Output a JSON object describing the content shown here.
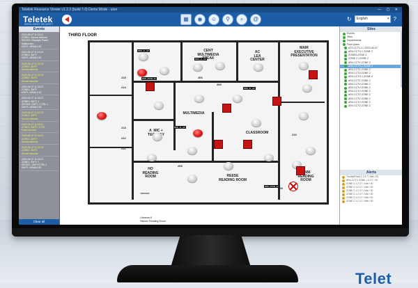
{
  "window": {
    "title": "Telelink Resource Viewer v1.2.3 (build 7.0) Demo Mode - user"
  },
  "header": {
    "logo": "Teletek",
    "logo_sub": "INTELLIGENT SECURITY",
    "toolbar_icons": [
      "grid-icon",
      "wifi-icon",
      "user-icon",
      "search-user-icon",
      "search-icon",
      "at-icon"
    ],
    "language": "English"
  },
  "events_panel": {
    "title": "Events",
    "items": [
      {
        "color": "white",
        "lines": [
          "2023-06-07 11:22:21",
          "ZONE1: Smoke detector",
          "DEVICE: Repetyle Power Malfunction",
          "UNIT1: AR4ALK18"
        ]
      },
      {
        "color": "white",
        "lines": [
          "2023-06-07 11:22:21",
          "ZONE1: ZMTY",
          "UNIT1: AR4ALK18"
        ]
      },
      {
        "color": "yellow",
        "lines": [
          "2023-06-07 11:22:21",
          "ZONE1: ZMTY",
          "Smoke detector"
        ]
      },
      {
        "color": "yellow",
        "lines": [
          "2023-06-07 11:22:21",
          "ZONE1: ZMTY",
          "Smoke detector"
        ]
      },
      {
        "color": "white",
        "lines": [
          "2023-06-07 11:22:21",
          "ZONE1: ZMTY",
          "UNIT1: AR4ALK18"
        ]
      },
      {
        "color": "white",
        "lines": [
          "2023-06-07 11:22:21",
          "ZONE1: ZMTY 1",
          "DEVICE: ZMTY / CTRL 1",
          "UNIT1: AR4ALK18"
        ]
      },
      {
        "color": "yellow",
        "lines": [
          "2023-06-07 11:22:21",
          "ZONE1: ZMTY",
          "Smoke detector"
        ]
      },
      {
        "color": "yellow",
        "lines": [
          "2023-06-07 11:22:21",
          "ZONE1: ZMTY / CTRL",
          "Fault reported"
        ]
      },
      {
        "color": "yellow",
        "lines": [
          "2023-06-07 11:22:21",
          "ZONE1: ZMTY",
          "Smoke detector"
        ]
      },
      {
        "color": "yellow",
        "lines": [
          "2023-06-07 11:22:21",
          "ZONE1: ZMTY",
          "Smoke detector"
        ]
      },
      {
        "color": "white",
        "lines": [
          "2023-06-07 11:22:21",
          "ZONE1: ZMTY 1",
          "DEVICE: ZMTY/CTRL 1",
          "UNIT1: AR4ALK18"
        ]
      }
    ],
    "clear_label": "Clear all"
  },
  "map": {
    "floor_title": "THIRD FLOOR",
    "rooms": [
      {
        "name": "CENT\nMULTIMEDIA\nSPEAK"
      },
      {
        "name": "AC\nLEA\nCENTER"
      },
      {
        "name": "MAIR\nEXECUTIVE\nPRESENTATION"
      },
      {
        "name": "MULTIMEDIA"
      },
      {
        "name": "A  MIC +\nTEC  OGY"
      },
      {
        "name": "CLASSROOM"
      },
      {
        "name": "HO\nREADING\nROOM"
      },
      {
        "name": "REESE\nREADING ROOM"
      },
      {
        "name": "LINNI\nREADING\nROOM"
      },
      {
        "name": "OFFICES"
      }
    ],
    "room_numbers": [
      "215",
      "214",
      "213",
      "212",
      "211",
      "205",
      "206",
      "209",
      "208",
      "210"
    ],
    "note": "Librarian 6\nHistoric Reading Room"
  },
  "sites_panel": {
    "title": "Sites",
    "tree": [
      {
        "label": "Events",
        "level": 0,
        "sel": false
      },
      {
        "label": "Sites",
        "level": 0,
        "sel": false
      },
      {
        "label": "Departments",
        "level": 0,
        "sel": false
      },
      {
        "label": "Floor plans",
        "level": 0,
        "sel": false
      },
      {
        "label": "ATV-CCTV-1 / 2023-06-07",
        "level": 1,
        "sel": false
      },
      {
        "label": "AR4-CCTV-1 ZONE 2",
        "level": 1,
        "sel": false
      },
      {
        "label": "ZONE3-ZONE 4",
        "level": 1,
        "sel": false
      },
      {
        "label": "ZONE 2 / ZONE 2",
        "level": 1,
        "sel": false
      },
      {
        "label": "AR4 CCTV ZONE 2",
        "level": 1,
        "sel": false
      },
      {
        "label": "AR4-CCTV-1 ZONE 2",
        "level": 1,
        "sel": true
      },
      {
        "label": "AR4 CCTV ZONE 2",
        "level": 1,
        "sel": false
      },
      {
        "label": "AR4 CCTV ZONE 2",
        "level": 1,
        "sel": false
      },
      {
        "label": "AR4-CCTV-1 ZONE 2",
        "level": 1,
        "sel": false
      },
      {
        "label": "AR4 CCTV ZONE 2",
        "level": 1,
        "sel": false
      },
      {
        "label": "AR4 CCTV ZONE 2",
        "level": 1,
        "sel": false
      },
      {
        "label": "AR4 CCTV ZONE 2",
        "level": 1,
        "sel": false
      },
      {
        "label": "AR4 CCTV ZONE 2",
        "level": 1,
        "sel": false
      },
      {
        "label": "AR4 CCTV ZONE 2",
        "level": 1,
        "sel": false
      },
      {
        "label": "AR4 CCTV ZONE 2",
        "level": 1,
        "sel": false
      },
      {
        "label": "AR4 CCTV ZONE 2",
        "level": 1,
        "sel": false
      },
      {
        "label": "AR4 CCTV ZONE 2",
        "level": 1,
        "sel": false
      }
    ]
  },
  "alerts_panel": {
    "title": "Alerts",
    "items": [
      "Trouble/Fault 1.2.3.7 / Idle / 00",
      "AR4-CCTV ZONE 1.2.3.7 / 00",
      "ZONE 2.1.2.3.7 / Idle / 00",
      "ZONE 2.1.2.3.7 / Idle / 00",
      "ZONE 2.1.2.3.7 / Idle / 00",
      "ZONE 2.1.2.3.7 / Idle / 00",
      "ZONE 2.1.2.3.7 / Idle / 00",
      "ZONE 2.1.2.3.7 / Idle / 00"
    ]
  },
  "brand_corner": "Telet"
}
